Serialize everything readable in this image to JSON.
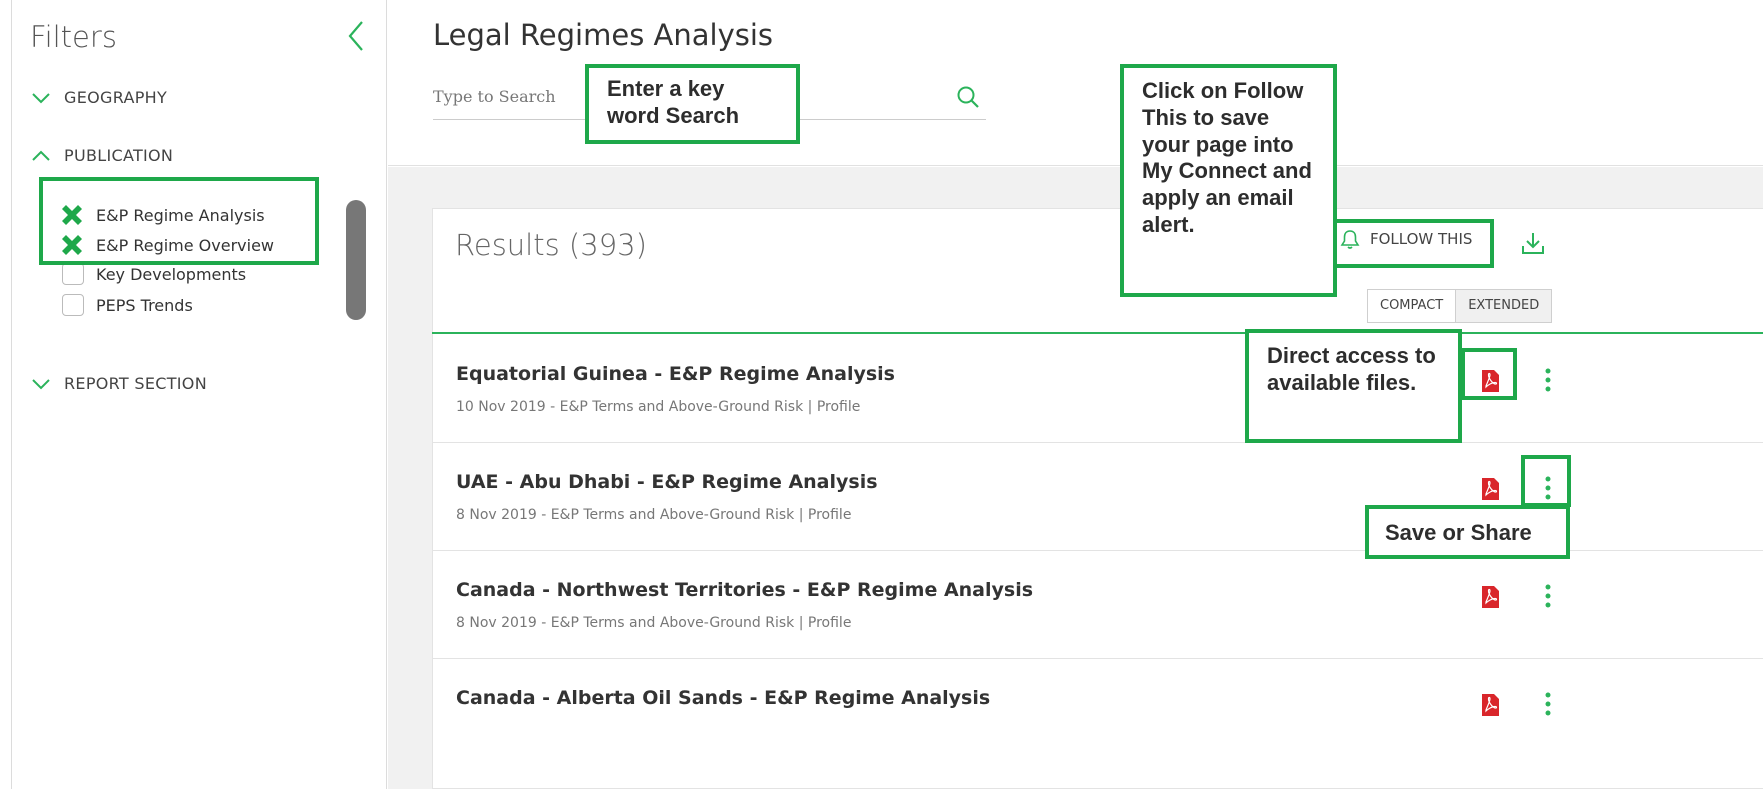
{
  "sidebar": {
    "title": "Filters",
    "sections": {
      "geography": "GEOGRAPHY",
      "publication": "PUBLICATION",
      "report_section": "REPORT SECTION"
    },
    "publication_options": [
      {
        "label": "E&P Regime Analysis",
        "selected": true
      },
      {
        "label": "E&P Regime Overview",
        "selected": true
      },
      {
        "label": "Key Developments",
        "selected": false
      },
      {
        "label": "PEPS Trends",
        "selected": false
      }
    ]
  },
  "header": {
    "title": "Legal Regimes Analysis",
    "search_placeholder": "Type to Search"
  },
  "results": {
    "title": "Results (393)",
    "follow_label": "FOLLOW THIS",
    "view_options": [
      "COMPACT",
      "EXTENDED"
    ],
    "active_view": "EXTENDED",
    "items": [
      {
        "title": "Equatorial Guinea - E&P Regime Analysis",
        "meta": "10 Nov 2019 - E&P Terms and Above-Ground Risk | Profile"
      },
      {
        "title": "UAE - Abu Dhabi - E&P Regime Analysis",
        "meta": "8 Nov 2019 - E&P Terms and Above-Ground Risk | Profile"
      },
      {
        "title": "Canada - Northwest Territories - E&P Regime Analysis",
        "meta": "8 Nov 2019 - E&P Terms and Above-Ground Risk | Profile"
      },
      {
        "title": "Canada - Alberta Oil Sands - E&P Regime Analysis",
        "meta": ""
      }
    ]
  },
  "callouts": {
    "search": "Enter a key word Search",
    "follow": "Click on Follow This to save your page into My Connect and apply an email alert.",
    "files": "Direct access to available files.",
    "share": "Save or Share"
  },
  "colors": {
    "accent_green": "#1ea84a",
    "pdf_red": "#d9262b"
  }
}
